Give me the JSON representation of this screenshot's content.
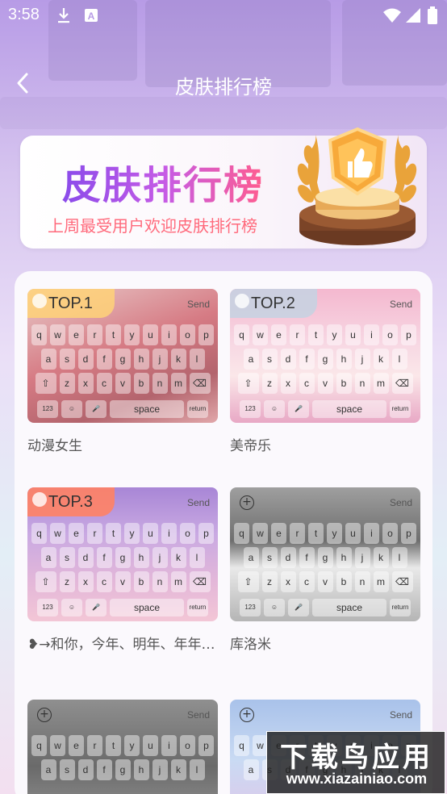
{
  "status_bar": {
    "time": "3:58",
    "icons": [
      "download-icon",
      "a-notification-icon",
      "wifi-icon",
      "signal-icon",
      "battery-icon"
    ]
  },
  "nav": {
    "back_icon": "chevron-left-icon",
    "title": "皮肤排行榜"
  },
  "banner": {
    "title": "皮肤排行榜",
    "subtitle": "上周最受用户欢迎皮肤排行榜",
    "image": "trophy-illustration"
  },
  "keyboard": {
    "row1": [
      "q",
      "w",
      "e",
      "r",
      "t",
      "y",
      "u",
      "i",
      "o",
      "p"
    ],
    "row2": [
      "a",
      "s",
      "d",
      "f",
      "g",
      "h",
      "j",
      "k",
      "l"
    ],
    "row3": [
      "z",
      "x",
      "c",
      "v",
      "b",
      "n",
      "m"
    ],
    "send": "Send",
    "space": "space",
    "num": "123",
    "ret": "return"
  },
  "skins": [
    {
      "rank": "TOP.1",
      "name": "动漫女生"
    },
    {
      "rank": "TOP.2",
      "name": "美帝乐"
    },
    {
      "rank": "TOP.3",
      "name": "❥→和你，今年、明年、年年…"
    },
    {
      "rank": "",
      "name": "库洛米"
    },
    {
      "rank": "",
      "name": ""
    },
    {
      "rank": "",
      "name": ""
    }
  ],
  "watermark": {
    "title": "下载鸟应用",
    "url": "www.xiazainiao.com"
  }
}
